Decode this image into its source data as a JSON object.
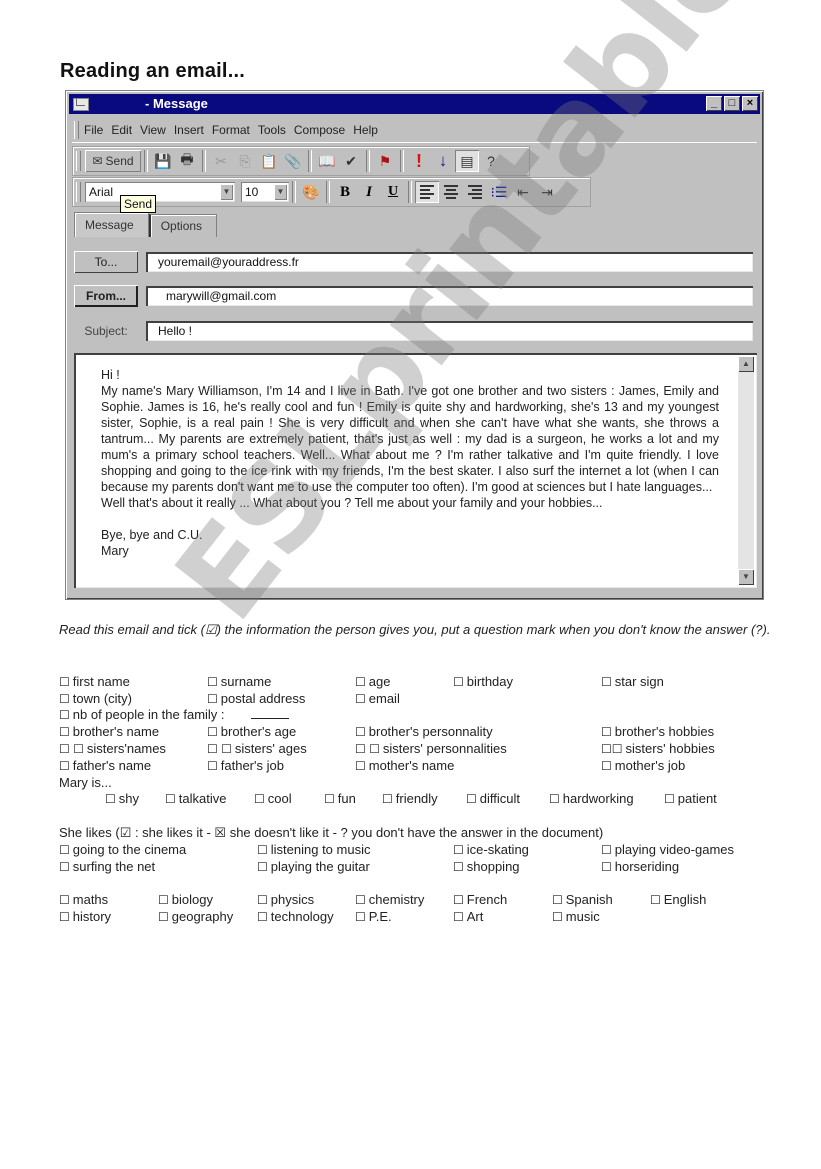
{
  "page_title": "Reading an email...",
  "window": {
    "title": "- Message",
    "controls": {
      "minimize": "_",
      "maximize": "□",
      "close": "×"
    },
    "menu": [
      "File",
      "Edit",
      "View",
      "Insert",
      "Format",
      "Tools",
      "Compose",
      "Help"
    ],
    "toolbar": {
      "send_label": "Send",
      "tooltip": "Send",
      "font_name": "Arial",
      "font_size": "10"
    },
    "tabs": [
      "Message",
      "Options"
    ],
    "fields": {
      "to_label": "To...",
      "to_value": "youremail@youraddress.fr",
      "from_label": "From...",
      "from_value": "marywill@gmail.com",
      "subject_label": "Subject:",
      "subject_value": "Hello !"
    },
    "body": {
      "greeting": "Hi !",
      "paragraph": "My name's Mary Williamson, I'm 14 and I live in Bath. I've got one brother and two sisters : James, Emily and Sophie. James is 16, he's really cool and fun ! Emily is quite shy and hardworking, she's 13 and my youngest sister, Sophie, is a real pain ! She is very difficult and when she can't have what she wants, she throws a tantrum... My parents are extremely patient, that's just as well : my dad is a surgeon, he works a lot and my mum's a primary school teachers. Well... What about me ? I'm rather talkative and I'm quite friendly. I love shopping and going to the ice rink with my friends, I'm the best skater. I also surf the internet a lot (when I can because my parents don't want me to use the computer too often). I'm good at sciences but I hate languages...",
      "closing_line": "Well that's about it really ... What about you ? Tell me about your family and your hobbies...",
      "signoff": "Bye, bye and C.U.",
      "signature": "Mary"
    }
  },
  "worksheet": {
    "instructions": "Read this email and tick (☑) the information the person gives you, put a question mark when you don't know the answer (?).",
    "info_row1": [
      "first name",
      "surname",
      "age",
      "birthday",
      "star sign"
    ],
    "info_row2": [
      "town (city)",
      "postal address",
      "email"
    ],
    "family_count_label": "nb of people in the family :",
    "family_row1": [
      "brother's name",
      "brother's age",
      "brother's personnality",
      "brother's hobbies"
    ],
    "family_row2": [
      "sisters'names",
      "sisters' ages",
      "sisters' personnalities",
      "sisters' hobbies"
    ],
    "family_row3": [
      "father's name",
      "father's job",
      "mother's name",
      "mother's job"
    ],
    "mary_is_label": "Mary is...",
    "traits": [
      "shy",
      "talkative",
      "cool",
      "fun",
      "friendly",
      "difficult",
      "hardworking",
      "patient"
    ],
    "likes_legend": "She likes (☑ : she likes it - ☒ she doesn't like it -  ? you don't have the answer in the document)",
    "likes_row1": [
      "going to the cinema",
      "listening to music",
      "ice-skating",
      "playing video-games"
    ],
    "likes_row2": [
      "surfing the net",
      "playing the guitar",
      "shopping",
      "horseriding"
    ],
    "subjects_row1": [
      "maths",
      "biology",
      "physics",
      "chemistry",
      "French",
      "Spanish",
      "English"
    ],
    "subjects_row2": [
      "history",
      "geography",
      "technology",
      "P.E.",
      "Art",
      "music"
    ]
  },
  "watermark": "ESLprintables.com"
}
